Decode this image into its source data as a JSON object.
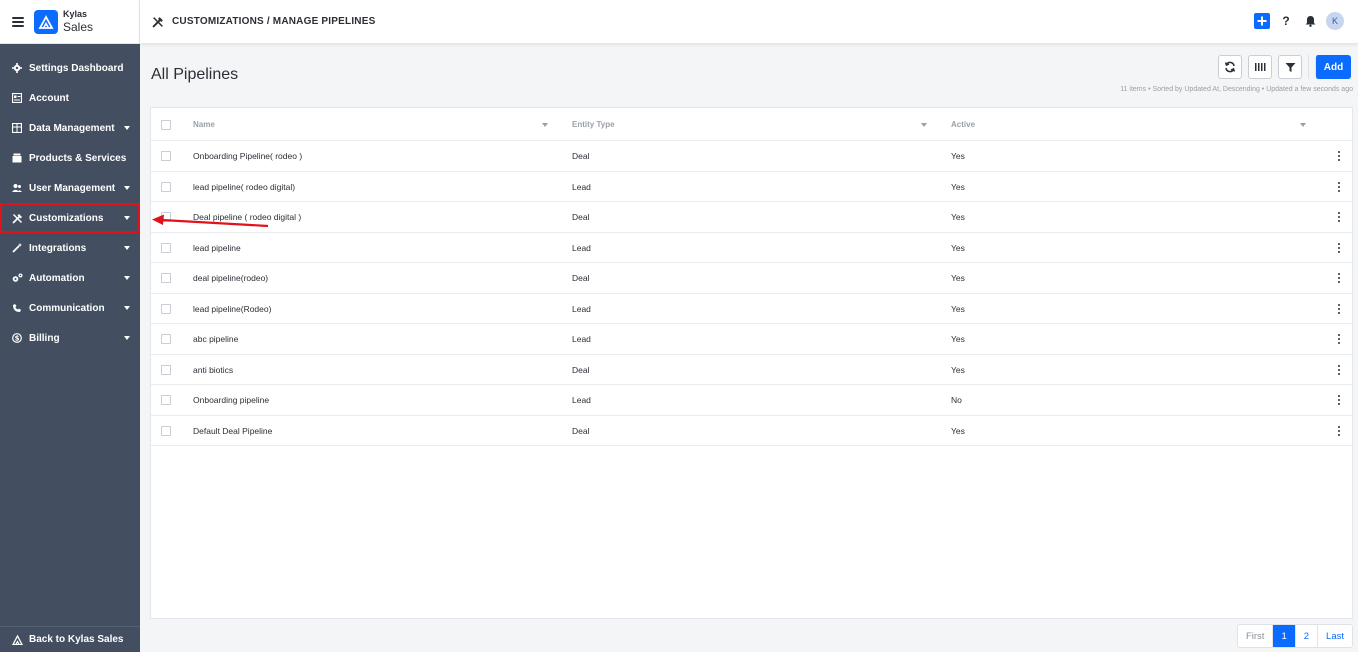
{
  "app": {
    "brand_top": "Kylas",
    "brand_bottom": "Sales",
    "accent_color": "#0b6bff",
    "sidebar_color": "#434e60"
  },
  "sidebar": {
    "items": [
      {
        "label": "Settings Dashboard",
        "icon": "gear-icon",
        "has_caret": false
      },
      {
        "label": "Account",
        "icon": "account-icon",
        "has_caret": false
      },
      {
        "label": "Data Management",
        "icon": "table-icon",
        "has_caret": true
      },
      {
        "label": "Products & Services",
        "icon": "box-icon",
        "has_caret": false
      },
      {
        "label": "User Management",
        "icon": "users-icon",
        "has_caret": true
      },
      {
        "label": "Customizations",
        "icon": "tools-icon",
        "has_caret": true,
        "highlighted": true
      },
      {
        "label": "Integrations",
        "icon": "magic-wand-icon",
        "has_caret": true
      },
      {
        "label": "Automation",
        "icon": "cogs-icon",
        "has_caret": true
      },
      {
        "label": "Communication",
        "icon": "phone-icon",
        "has_caret": true
      },
      {
        "label": "Billing",
        "icon": "dollar-icon",
        "has_caret": true
      }
    ],
    "back_label": "Back to Kylas Sales"
  },
  "header": {
    "breadcrumb": "CUSTOMIZATIONS / MANAGE PIPELINES",
    "avatar_initial": "K",
    "help_label": "?"
  },
  "main": {
    "title": "All Pipelines",
    "add_label": "Add",
    "summary": "11 items • Sorted by Updated At, Descending • Updated a few seconds ago"
  },
  "table": {
    "columns": [
      "Name",
      "Entity Type",
      "Active"
    ],
    "rows": [
      {
        "name": "Onboarding Pipeline( rodeo )",
        "entity": "Deal",
        "active": "Yes"
      },
      {
        "name": "lead pipeline( rodeo digital)",
        "entity": "Lead",
        "active": "Yes"
      },
      {
        "name": "Deal pipeline ( rodeo digital )",
        "entity": "Deal",
        "active": "Yes"
      },
      {
        "name": "lead pipeline",
        "entity": "Lead",
        "active": "Yes"
      },
      {
        "name": "deal pipeline(rodeo)",
        "entity": "Deal",
        "active": "Yes"
      },
      {
        "name": "lead pipeline(Rodeo)",
        "entity": "Lead",
        "active": "Yes"
      },
      {
        "name": "abc pipeline",
        "entity": "Lead",
        "active": "Yes"
      },
      {
        "name": "anti biotics",
        "entity": "Deal",
        "active": "Yes"
      },
      {
        "name": "Onboarding pipeline",
        "entity": "Lead",
        "active": "No"
      },
      {
        "name": "Default Deal Pipeline",
        "entity": "Deal",
        "active": "Yes"
      }
    ]
  },
  "pagination": {
    "first": "First",
    "pages": [
      "1",
      "2"
    ],
    "current": "1",
    "last": "Last"
  }
}
